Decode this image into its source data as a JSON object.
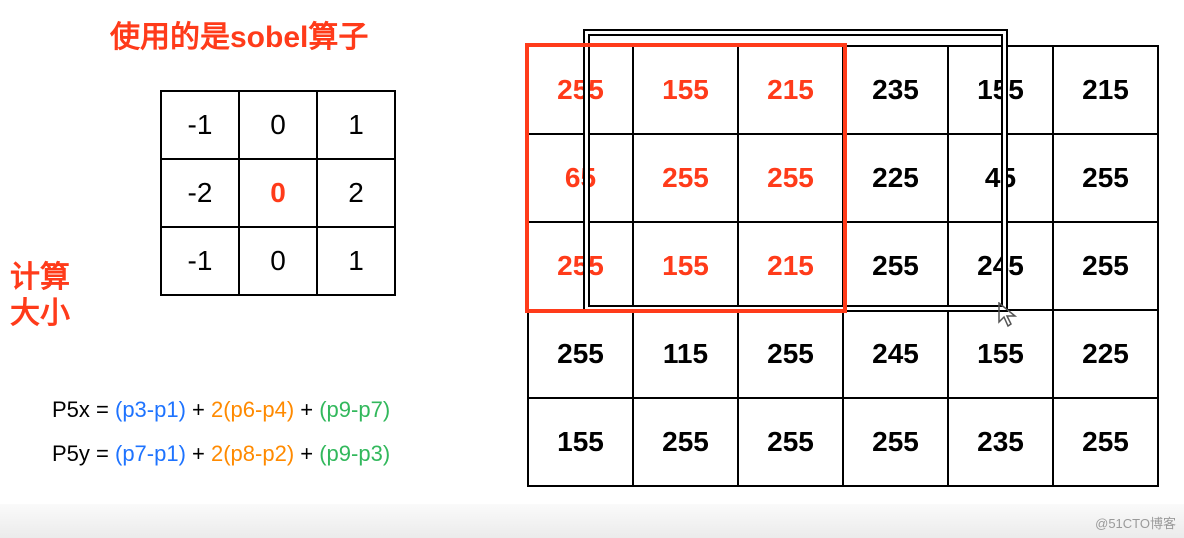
{
  "title": "使用的是sobel算子",
  "side_label_1": "计算",
  "side_label_2": "大小",
  "sobel": {
    "r0": [
      "-1",
      "0",
      "1"
    ],
    "r1": [
      "-2",
      "0",
      "2"
    ],
    "r2": [
      "-1",
      "0",
      "1"
    ]
  },
  "formula": {
    "p5x_left": "P5x",
    "p5y_left": "P5y",
    "eq": "  = ",
    "x_a": "(p3-p1)",
    "x_b": "2(p6-p4)",
    "x_c": "(p9-p7)",
    "y_a": "(p7-p1)",
    "y_b": "2(p8-p2)",
    "y_c": "(p9-p3)",
    "plus": " + "
  },
  "pixels": {
    "r0": [
      "255",
      "155",
      "215",
      "235",
      "155",
      "215"
    ],
    "r1": [
      "65",
      "255",
      "255",
      "225",
      "45",
      "255"
    ],
    "r2": [
      "255",
      "155",
      "215",
      "255",
      "245",
      "255"
    ],
    "r3": [
      "255",
      "115",
      "255",
      "245",
      "155",
      "225"
    ],
    "r4": [
      "155",
      "255",
      "255",
      "255",
      "235",
      "255"
    ]
  },
  "watermark": "@51CTO博客"
}
